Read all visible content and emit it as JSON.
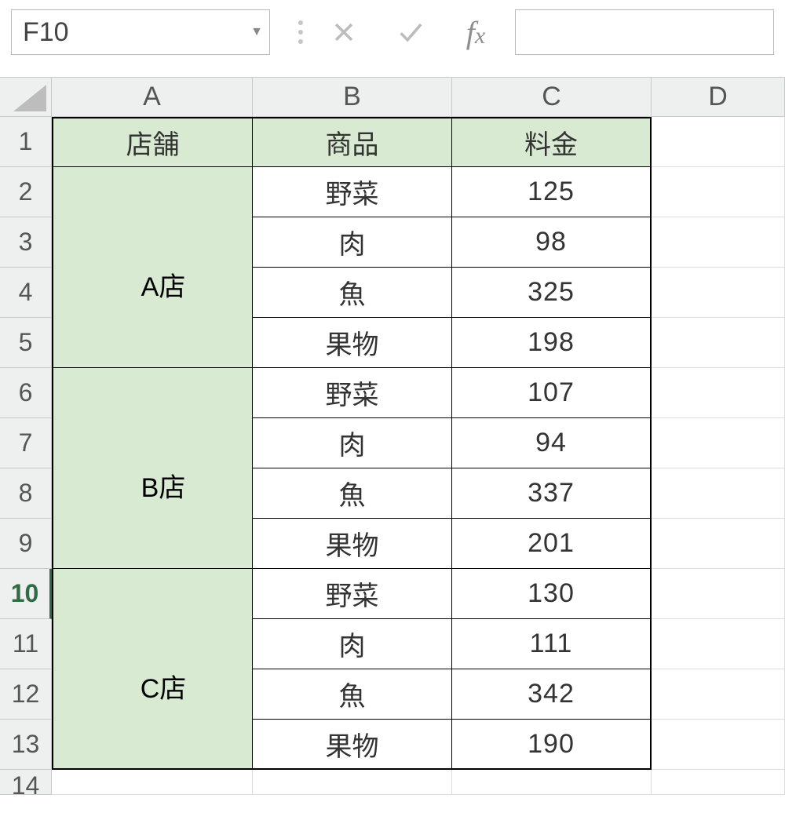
{
  "name_box": "F10",
  "columns": {
    "A": "A",
    "B": "B",
    "C": "C",
    "D": "D"
  },
  "rows": {
    "1": "1",
    "2": "2",
    "3": "3",
    "4": "4",
    "5": "5",
    "6": "6",
    "7": "7",
    "8": "8",
    "9": "9",
    "10": "10",
    "11": "11",
    "12": "12",
    "13": "13",
    "14": "14"
  },
  "active_row": "10",
  "table": {
    "headers": {
      "A": "店舗",
      "B": "商品",
      "C": "料金"
    },
    "groups": [
      {
        "label": "A店",
        "rows": [
          {
            "item": "野菜",
            "price": "125"
          },
          {
            "item": "肉",
            "price": "98"
          },
          {
            "item": "魚",
            "price": "325"
          },
          {
            "item": "果物",
            "price": "198"
          }
        ]
      },
      {
        "label": "B店",
        "rows": [
          {
            "item": "野菜",
            "price": "107"
          },
          {
            "item": "肉",
            "price": "94"
          },
          {
            "item": "魚",
            "price": "337"
          },
          {
            "item": "果物",
            "price": "201"
          }
        ]
      },
      {
        "label": "C店",
        "rows": [
          {
            "item": "野菜",
            "price": "130"
          },
          {
            "item": "肉",
            "price": "111"
          },
          {
            "item": "魚",
            "price": "342"
          },
          {
            "item": "果物",
            "price": "190"
          }
        ]
      }
    ]
  }
}
